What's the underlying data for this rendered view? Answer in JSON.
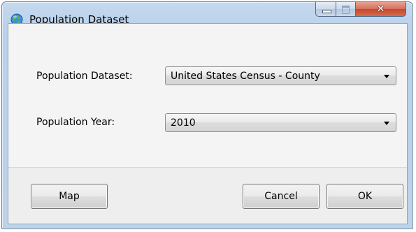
{
  "window": {
    "title": "Population Dataset",
    "icon": "globe-icon",
    "caption_buttons": [
      "minimize",
      "maximize",
      "close"
    ],
    "colors": {
      "frame": "#b9d1ea",
      "close_button": "#c7472d"
    }
  },
  "form": {
    "dataset_label": "Population Dataset:",
    "dataset_value": "United States Census - County",
    "year_label": "Population Year:",
    "year_value": "2010"
  },
  "buttons": {
    "map": "Map",
    "cancel": "Cancel",
    "ok": "OK"
  }
}
